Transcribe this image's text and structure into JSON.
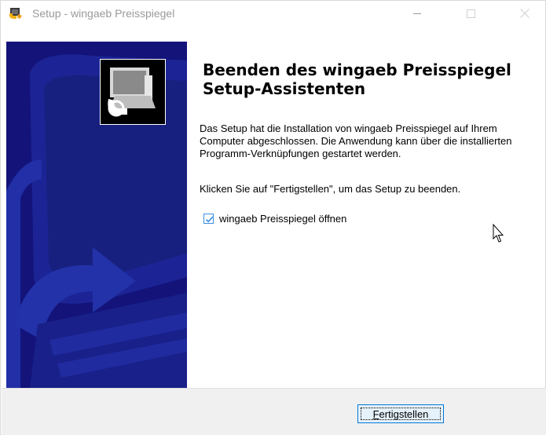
{
  "window": {
    "title": "Setup - wingaeb Preisspiegel"
  },
  "heading": "Beenden des wingaeb Preisspiegel Setup-Assistenten",
  "paragraphs": {
    "info": "Das Setup hat die Installation von wingaeb Preisspiegel auf Ihrem Computer abgeschlossen. Die Anwendung kann über die installierten Programm-Verknüpfungen gestartet werden.",
    "instruction": "Klicken Sie auf \"Fertigstellen\", um das Setup zu beenden."
  },
  "checkbox": {
    "label": "wingaeb Preisspiegel öffnen",
    "checked": true
  },
  "footer": {
    "finish_button": {
      "mnemonic": "F",
      "rest": "ertigstellen"
    }
  },
  "colors": {
    "banner_dark": "#13137a",
    "banner_mid": "#1e2a9e",
    "button_border": "#0078d7",
    "checkbox_blue": "#3c8de0"
  },
  "icons": [
    "setup-app-icon",
    "minimize-icon",
    "maximize-icon",
    "close-icon",
    "computer-setup-icon",
    "checkmark-icon",
    "mouse-cursor-icon"
  ]
}
